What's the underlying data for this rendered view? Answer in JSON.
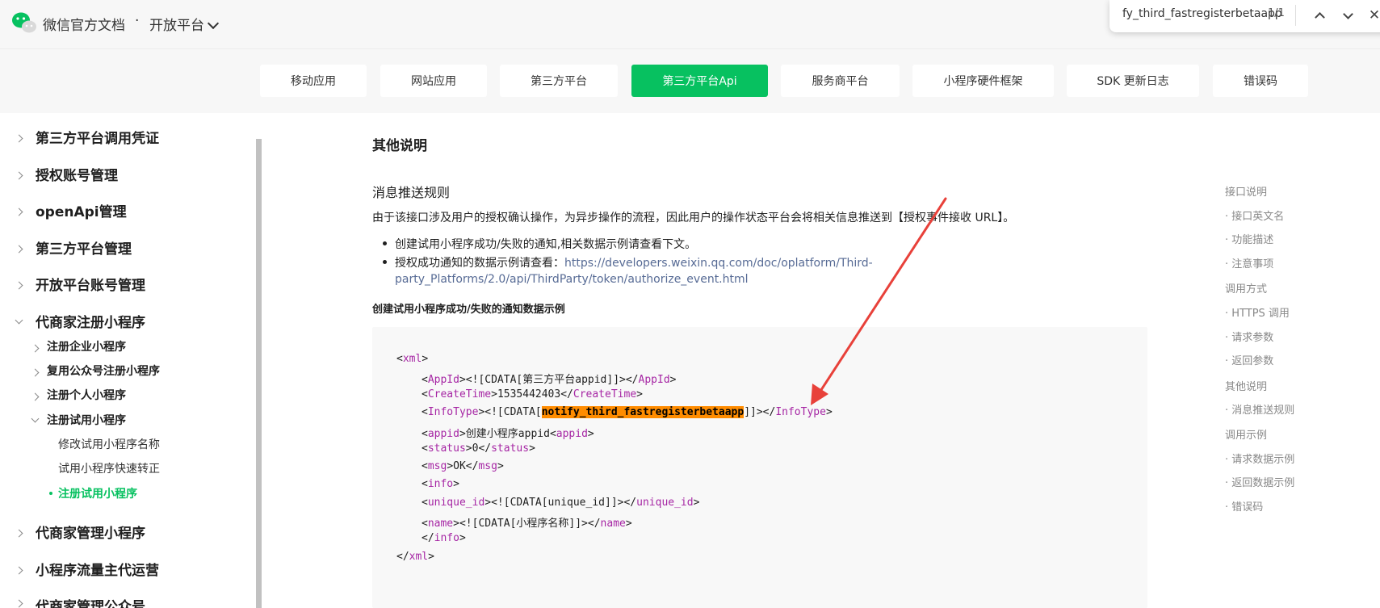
{
  "header": {
    "brand": "微信官方文档",
    "dot": "·",
    "platform": "开放平台"
  },
  "find": {
    "query": "fy_third_fastregisterbetaapp",
    "count": "1/1",
    "close": "✕"
  },
  "tabs": [
    {
      "label": "移动应用"
    },
    {
      "label": "网站应用"
    },
    {
      "label": "第三方平台"
    },
    {
      "label": "第三方平台Api",
      "active": true
    },
    {
      "label": "服务商平台"
    },
    {
      "label": "小程序硬件框架"
    },
    {
      "label": "SDK 更新日志"
    },
    {
      "label": "错误码"
    }
  ],
  "sidebar": {
    "items": [
      {
        "label": "第三方平台调用凭证",
        "level": 1
      },
      {
        "label": "授权账号管理",
        "level": 1
      },
      {
        "label": "openApi管理",
        "level": 1
      },
      {
        "label": "第三方平台管理",
        "level": 1
      },
      {
        "label": "开放平台账号管理",
        "level": 1
      },
      {
        "label": "代商家注册小程序",
        "level": 1,
        "expanded": true
      },
      {
        "label": "注册企业小程序",
        "level": 2
      },
      {
        "label": "复用公众号注册小程序",
        "level": 2
      },
      {
        "label": "注册个人小程序",
        "level": 2
      },
      {
        "label": "注册试用小程序",
        "level": 2,
        "expanded": true
      },
      {
        "label": "修改试用小程序名称",
        "level": 3
      },
      {
        "label": "试用小程序快速转正",
        "level": 3
      },
      {
        "label": "注册试用小程序",
        "level": 3,
        "active": true
      },
      {
        "label": "代商家管理小程序",
        "level": 1
      },
      {
        "label": "小程序流量主代运营",
        "level": 1
      },
      {
        "label": "代商家管理公众号",
        "level": 1
      }
    ]
  },
  "content": {
    "heading_other": "其他说明",
    "heading_rule": "消息推送规则",
    "para": "由于该接口涉及用户的授权确认操作，为异步操作的流程，因此用户的操作状态平台会将相关信息推送到【授权事件接收 URL】。",
    "bullet1": "创建试用小程序成功/失败的通知,相关数据示例请查看下文。",
    "bullet2_prefix": "授权成功通知的数据示例请查看：",
    "bullet2_link_line1": "https://developers.weixin.qq.com/doc/oplatform/Third-",
    "bullet2_link_line2": "party_Platforms/2.0/api/ThirdParty/token/authorize_event.html",
    "subheading": "创建试用小程序成功/失败的通知数据示例"
  },
  "code": {
    "xml_open": "xml",
    "appid_tag": "AppId",
    "appid_val": "<![CDATA[第三方平台appid]]>",
    "createtime_tag": "CreateTime",
    "createtime_val": "1535442403",
    "infotype_tag": "InfoType",
    "infotype_pre": "<![CDATA[",
    "infotype_hl": "notify_third_fastregisterbetaapp",
    "infotype_post": "]]>",
    "appid2_tag": "appid",
    "appid2_val": "创建小程序appid",
    "status_tag": "status",
    "status_val": "0",
    "msg_tag": "msg",
    "msg_val": "OK",
    "info_tag": "info",
    "uniqueid_tag": "unique_id",
    "uniqueid_val": "<![CDATA[unique_id]]>",
    "name_tag": "name",
    "name_val": "<![CDATA[小程序名称]]>"
  },
  "toc": [
    {
      "label": "接口说明"
    },
    {
      "label": "· 接口英文名"
    },
    {
      "label": "· 功能描述"
    },
    {
      "label": "· 注意事项"
    },
    {
      "label": "调用方式"
    },
    {
      "label": "· HTTPS 调用"
    },
    {
      "label": "· 请求参数"
    },
    {
      "label": "· 返回参数"
    },
    {
      "label": "其他说明"
    },
    {
      "label": "· 消息推送规则"
    },
    {
      "label": "调用示例"
    },
    {
      "label": "· 请求数据示例"
    },
    {
      "label": "· 返回数据示例"
    },
    {
      "label": "· 错误码"
    }
  ],
  "colors": {
    "brand_green": "#07c160",
    "link": "#576b95",
    "highlight": "#ff8c00",
    "arrow": "#e8413a"
  }
}
